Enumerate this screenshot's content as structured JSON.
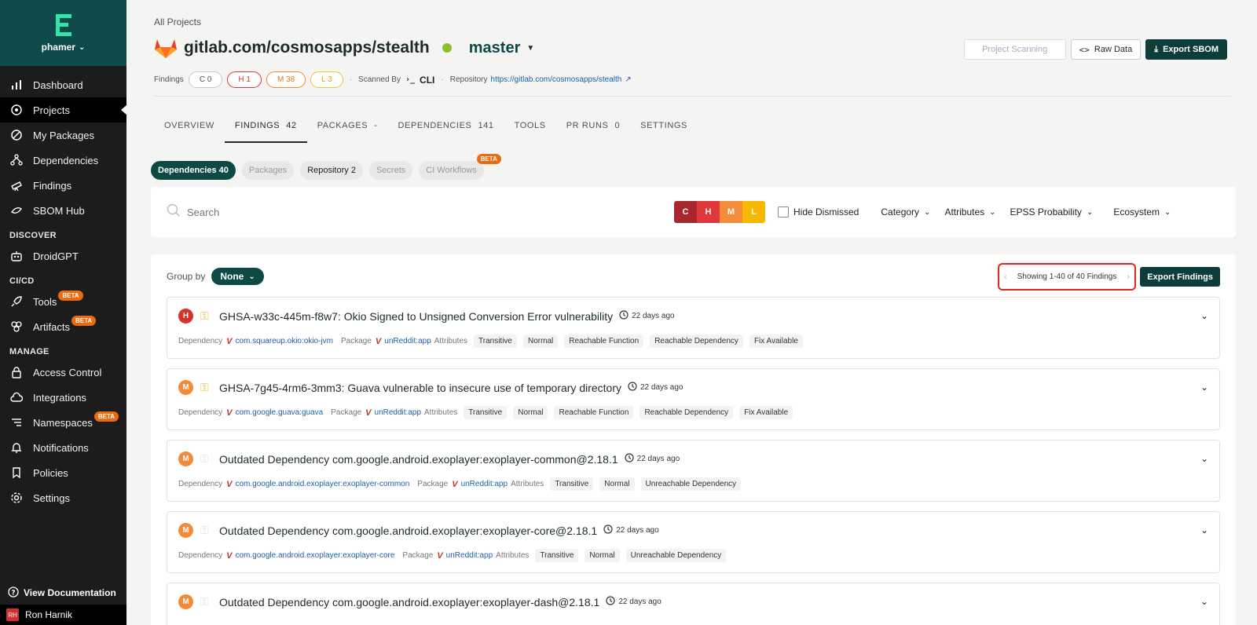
{
  "sidebar": {
    "user": "phamer",
    "items_main": [
      {
        "label": "Dashboard",
        "icon": "chart-bars-icon"
      },
      {
        "label": "Projects",
        "icon": "projects-icon",
        "active": true
      },
      {
        "label": "My Packages",
        "icon": "package-icon"
      },
      {
        "label": "Dependencies",
        "icon": "dependencies-icon"
      },
      {
        "label": "Findings",
        "icon": "telescope-icon"
      },
      {
        "label": "SBOM Hub",
        "icon": "sbom-icon"
      }
    ],
    "discover_label": "DISCOVER",
    "discover_items": [
      {
        "label": "DroidGPT",
        "icon": "robot-icon"
      }
    ],
    "cicd_label": "CI/CD",
    "cicd_items": [
      {
        "label": "Tools",
        "icon": "rocket-icon",
        "badge": "BETA"
      },
      {
        "label": "Artifacts",
        "icon": "artifacts-icon",
        "badge": "BETA"
      }
    ],
    "manage_label": "MANAGE",
    "manage_items": [
      {
        "label": "Access Control",
        "icon": "lock-icon"
      },
      {
        "label": "Integrations",
        "icon": "cloud-icon"
      },
      {
        "label": "Namespaces",
        "icon": "namespaces-icon",
        "badge": "BETA"
      },
      {
        "label": "Notifications",
        "icon": "bell-icon"
      },
      {
        "label": "Policies",
        "icon": "bookmark-icon"
      },
      {
        "label": "Settings",
        "icon": "gear-icon"
      }
    ],
    "view_docs": "View Documentation",
    "current_user": "Ron Harnik",
    "current_user_initials": "RH"
  },
  "header": {
    "breadcrumb": "All Projects",
    "project_name": "gitlab.com/cosmosapps/stealth",
    "branch": "master",
    "findings_label": "Findings",
    "counts": {
      "c": "C 0",
      "h": "H 1",
      "m": "M 38",
      "l": "L 3"
    },
    "scanned_by_label": "Scanned By",
    "scanned_by_value": "CLI",
    "repository_label": "Repository",
    "repository_url": "https://gitlab.com/cosmosapps/stealth",
    "btn_project_scanning": "Project Scanning",
    "btn_raw_data": "Raw Data",
    "btn_export_sbom": "Export SBOM"
  },
  "tabs": [
    {
      "label": "OVERVIEW",
      "count": ""
    },
    {
      "label": "FINDINGS",
      "count": "42",
      "active": true
    },
    {
      "label": "PACKAGES",
      "count": "-"
    },
    {
      "label": "DEPENDENCIES",
      "count": "141"
    },
    {
      "label": "TOOLS",
      "count": ""
    },
    {
      "label": "PR RUNS",
      "count": "0"
    },
    {
      "label": "SETTINGS",
      "count": ""
    }
  ],
  "chips": [
    {
      "label": "Dependencies 40",
      "state": "active"
    },
    {
      "label": "Packages",
      "state": "disabled"
    },
    {
      "label": "Repository 2",
      "state": "normal"
    },
    {
      "label": "Secrets",
      "state": "disabled"
    },
    {
      "label": "CI Workflows",
      "state": "disabled",
      "badge": "BETA"
    }
  ],
  "filters": {
    "search_placeholder": "Search",
    "sev": [
      "C",
      "H",
      "M",
      "L"
    ],
    "hide_dismissed": "Hide Dismissed",
    "dropdowns": [
      "Category",
      "Attributes",
      "EPSS Probability",
      "Ecosystem"
    ]
  },
  "results": {
    "group_by_label": "Group by",
    "group_by_value": "None",
    "pager_text": "Showing 1-40 of 40 Findings",
    "export_findings": "Export Findings",
    "dependency_label": "Dependency",
    "package_label": "Package",
    "attributes_label": "Attributes",
    "findings": [
      {
        "sev": "H",
        "key": true,
        "title": "GHSA-w33c-445m-f8w7: Okio Signed to Unsigned Conversion Error vulnerability",
        "age": "22 days ago",
        "dependency": "com.squareup.okio:okio-jvm",
        "package": "unReddit:app",
        "attrs": [
          "Transitive",
          "Normal",
          "Reachable Function",
          "Reachable Dependency",
          "Fix Available"
        ]
      },
      {
        "sev": "M",
        "key": true,
        "title": "GHSA-7g45-4rm6-3mm3: Guava vulnerable to insecure use of temporary directory",
        "age": "22 days ago",
        "dependency": "com.google.guava:guava",
        "package": "unReddit:app",
        "attrs": [
          "Transitive",
          "Normal",
          "Reachable Function",
          "Reachable Dependency",
          "Fix Available"
        ]
      },
      {
        "sev": "M",
        "key": false,
        "title": "Outdated Dependency com.google.android.exoplayer:exoplayer-common@2.18.1",
        "age": "22 days ago",
        "dependency": "com.google.android.exoplayer:exoplayer-common",
        "package": "unReddit:app",
        "attrs": [
          "Transitive",
          "Normal",
          "Unreachable Dependency"
        ]
      },
      {
        "sev": "M",
        "key": false,
        "title": "Outdated Dependency com.google.android.exoplayer:exoplayer-core@2.18.1",
        "age": "22 days ago",
        "dependency": "com.google.android.exoplayer:exoplayer-core",
        "package": "unReddit:app",
        "attrs": [
          "Transitive",
          "Normal",
          "Unreachable Dependency"
        ]
      },
      {
        "sev": "M",
        "key": false,
        "title": "Outdated Dependency com.google.android.exoplayer:exoplayer-dash@2.18.1",
        "age": "22 days ago",
        "dependency": "",
        "package": "",
        "attrs": []
      }
    ]
  },
  "colors": {
    "brand": "#0d4a45",
    "sidebar": "#1c1c1c",
    "highlight": "#e3261f"
  }
}
